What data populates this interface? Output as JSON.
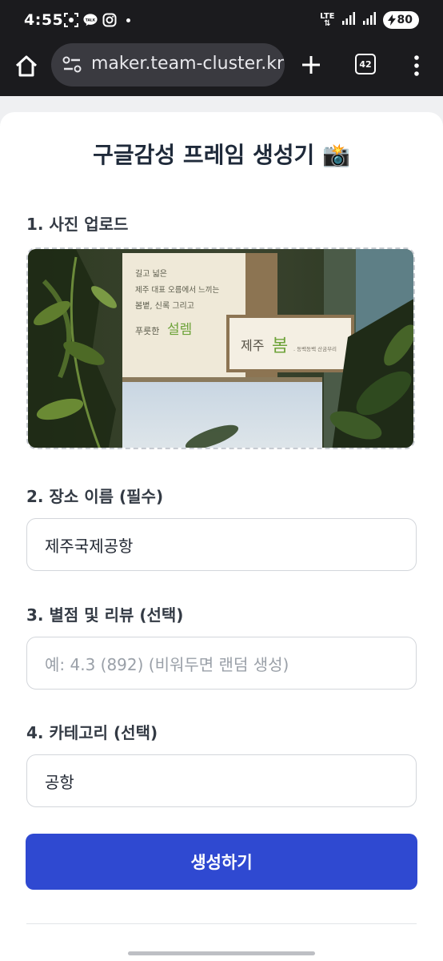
{
  "status_bar": {
    "time": "4:55",
    "network": "LTE",
    "battery": "80",
    "icons": [
      "screenshot-icon",
      "kakaotalk-icon",
      "instagram-icon",
      "notification-dot"
    ]
  },
  "browser": {
    "url": "maker.team-cluster.kr",
    "tab_count": "42"
  },
  "page": {
    "title": "구글감성 프레임 생성기 📸",
    "sections": {
      "upload_label": "1. 사진 업로드",
      "name_label": "2. 장소 이름 (필수)",
      "name_value": "제주국제공항",
      "review_label": "3. 별점 및 리뷰 (선택)",
      "review_placeholder": "예: 4.3 (892)  (비워두면 랜덤 생성)",
      "category_label": "4. 카테고리 (선택)",
      "category_value": "공항"
    },
    "photo": {
      "sign_lines": [
        "길고 넓은",
        "제주 대표 오름에서 느끼는",
        "봄볕, 신록 그리고",
        "푸릇한"
      ],
      "sign_highlight": "설렘",
      "sign2_text": "제주",
      "sign2_highlight": "봄",
      "sign2_sub": ". 동백동백 산굼부리"
    },
    "submit_label": "생성하기"
  },
  "colors": {
    "accent": "#2f49d1",
    "title": "#1f2a3a",
    "status_bar": "#1b1b1e"
  }
}
